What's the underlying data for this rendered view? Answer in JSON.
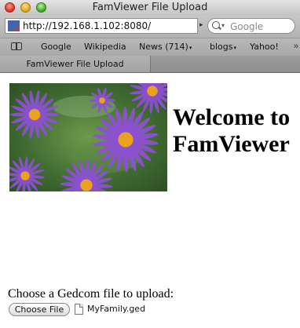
{
  "window": {
    "title": "FamViewer File Upload"
  },
  "toolbar": {
    "url": "http://192.168.1.102:8080/",
    "search_placeholder": "Google"
  },
  "bookmarks": [
    {
      "label": "Google",
      "dropdown": false
    },
    {
      "label": "Wikipedia",
      "dropdown": false
    },
    {
      "label": "News (714)",
      "dropdown": true
    },
    {
      "label": "blogs",
      "dropdown": true
    },
    {
      "label": "Yahoo!",
      "dropdown": false
    }
  ],
  "tabs": [
    {
      "label": "FamViewer File Upload",
      "active": true
    }
  ],
  "page": {
    "heading_line1": "Welcome to",
    "heading_line2": "FamViewer",
    "upload_prompt": "Choose a Gedcom file to upload:",
    "choose_button": "Choose File",
    "selected_file": "MyFamily.ged"
  },
  "colors": {
    "flower_petal": "#8f4fd6",
    "flower_center": "#e8a21d",
    "foliage": "#4b7a3e"
  }
}
